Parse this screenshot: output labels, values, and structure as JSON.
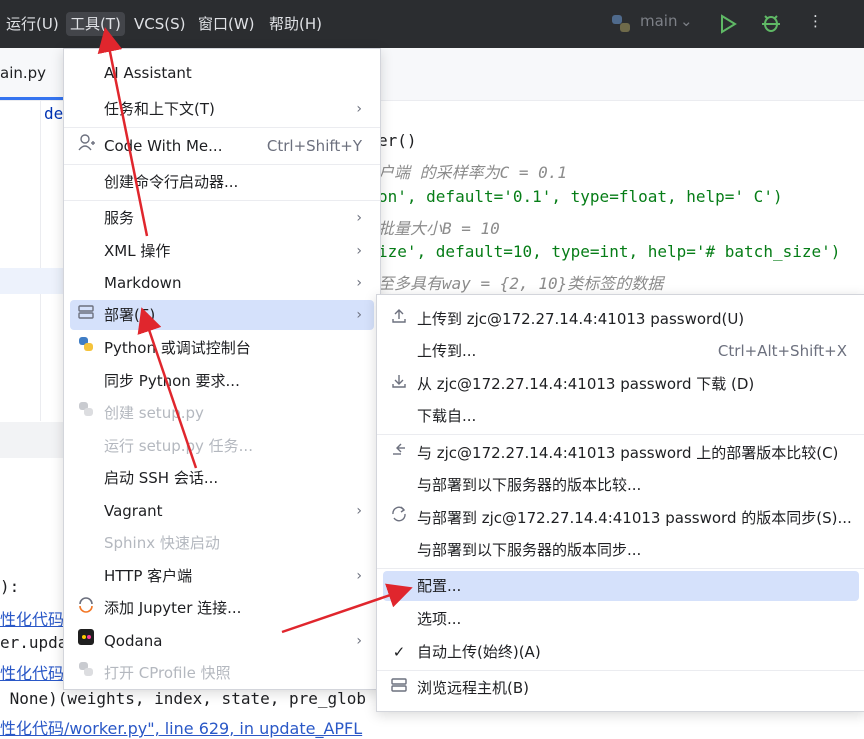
{
  "menubar": {
    "items": [
      "运行(U)",
      "工具(T)",
      "VCS(S)",
      "窗口(W)",
      "帮助(H)"
    ],
    "active_index": 1,
    "run_config": "main"
  },
  "editor": {
    "tab_label": "ain.py",
    "keyword_def": "de",
    "code_lines": [
      {
        "text": "er()"
      },
      {
        "text": "户端 的采样率为C = 0.1"
      },
      {
        "text": "on', default='0.1', type=float, help=' C')"
      },
      {
        "text": "批量大小B = 10"
      },
      {
        "text": "ize', default=10, type=int, help='# batch_size')"
      },
      {
        "text": "至多具有way = {2, 10}类标签的数据"
      }
    ],
    "console_lines": [
      "):",
      "性化代码/",
      "er.upda",
      "性化代码/",
      " None)(weights, index, state, pre_glob",
      "性化代码/worker.py\", line 629, in update_APFL"
    ]
  },
  "tools_menu": {
    "items": [
      {
        "label": "AI Assistant"
      },
      {
        "label": "任务和上下文(T)",
        "submenu": true
      },
      {
        "label": "Code With Me...",
        "shortcut": "Ctrl+Shift+Y",
        "icon": "person-add-icon"
      },
      {
        "label": "创建命令行启动器..."
      },
      {
        "label": "服务",
        "submenu": true
      },
      {
        "label": "XML 操作",
        "submenu": true
      },
      {
        "label": "Markdown",
        "submenu": true
      },
      {
        "label": "部署(E)",
        "submenu": true,
        "icon": "server-icon",
        "selected": true
      },
      {
        "label": "Python 或调试控制台",
        "icon": "python-icon"
      },
      {
        "label": "同步 Python 要求..."
      },
      {
        "label": "创建 setup.py",
        "disabled": true,
        "icon": "python-icon"
      },
      {
        "label": "运行 setup.py 任务...",
        "disabled": true
      },
      {
        "label": "启动 SSH 会话..."
      },
      {
        "label": "Vagrant",
        "submenu": true
      },
      {
        "label": "Sphinx 快速启动",
        "disabled": true
      },
      {
        "label": "HTTP 客户端",
        "submenu": true
      },
      {
        "label": "添加 Jupyter 连接...",
        "icon": "jupyter-icon"
      },
      {
        "label": "Qodana",
        "submenu": true,
        "icon": "qodana-icon"
      },
      {
        "label": "打开 CProfile 快照",
        "disabled": true,
        "icon": "python-icon"
      }
    ]
  },
  "deploy_menu": {
    "items": [
      {
        "label": "上传到 zjc@172.27.14.4:41013 password(U)",
        "icon": "upload-icon"
      },
      {
        "label": "上传到...",
        "shortcut": "Ctrl+Alt+Shift+X"
      },
      {
        "label": "从 zjc@172.27.14.4:41013 password 下载 (D)",
        "icon": "download-icon"
      },
      {
        "label": "下载自..."
      },
      {
        "label": "与 zjc@172.27.14.4:41013 password 上的部署版本比较(C)",
        "icon": "compare-icon"
      },
      {
        "label": "与部署到以下服务器的版本比较..."
      },
      {
        "label": "与部署到 zjc@172.27.14.4:41013 password 的版本同步(S)...",
        "icon": "sync-icon"
      },
      {
        "label": "与部署到以下服务器的版本同步..."
      },
      {
        "label": "配置...",
        "selected": true
      },
      {
        "label": "选项..."
      },
      {
        "label": "自动上传(始终)(A)",
        "icon": "check-icon"
      },
      {
        "label": "浏览远程主机(B)",
        "icon": "server-icon"
      }
    ]
  },
  "colors": {
    "arrow": "#e0262d",
    "selection": "#d5e1fb",
    "menubar": "#2b2d30"
  }
}
